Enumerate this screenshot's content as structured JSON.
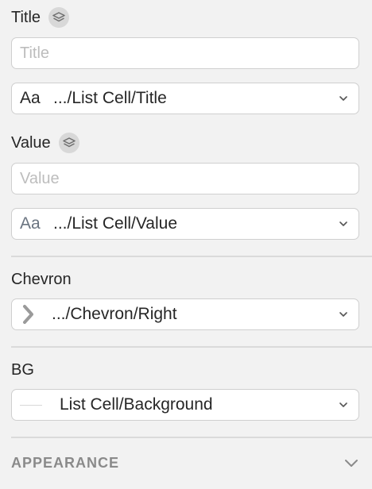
{
  "title_field": {
    "label": "Title",
    "placeholder": "Title",
    "value": "",
    "style_prefix": "Aa",
    "style_value": ".../List Cell/Title"
  },
  "value_field": {
    "label": "Value",
    "placeholder": "Value",
    "value": "",
    "style_prefix": "Aa",
    "style_value": ".../List Cell/Value"
  },
  "chevron_field": {
    "label": "Chevron",
    "symbol_value": ".../Chevron/Right",
    "icon": "chevron-right-icon"
  },
  "bg_field": {
    "label": "BG",
    "symbol_value": "List Cell/Background"
  },
  "appearance": {
    "heading": "APPEARANCE"
  },
  "colors": {
    "panel_bg": "#f2f2f2",
    "field_bg": "#ffffff",
    "border": "#cfcfcf",
    "muted_text": "#8a8a8a",
    "placeholder": "#bdbdbd"
  }
}
